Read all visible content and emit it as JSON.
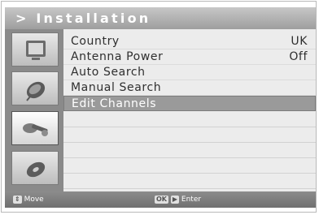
{
  "header": {
    "title": "> Installation"
  },
  "sidebar": {
    "items": [
      {
        "icon": "tv-icon",
        "active": false
      },
      {
        "icon": "satellite-dish-icon",
        "active": false
      },
      {
        "icon": "tools-icon",
        "active": true
      },
      {
        "icon": "disc-icon",
        "active": false
      }
    ]
  },
  "menu": {
    "items": [
      {
        "label": "Country",
        "value": "UK"
      },
      {
        "label": "Antenna Power",
        "value": "Off"
      },
      {
        "label": "Auto Search",
        "value": ""
      },
      {
        "label": "Manual Search",
        "value": ""
      },
      {
        "label": "Edit Channels",
        "value": "",
        "selected": true
      }
    ]
  },
  "footer": {
    "move_label": "Move",
    "ok_key": "OK",
    "enter_label": "Enter"
  },
  "colors": {
    "header": "#b3b3b3",
    "selected_row": "#9a9a9a",
    "panel": "#ececec",
    "sidebar": "#8a8a8a"
  }
}
